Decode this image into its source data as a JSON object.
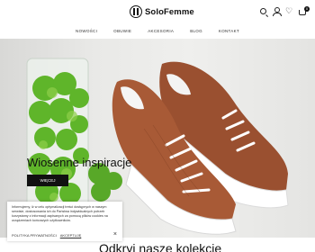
{
  "header": {
    "logo_text": "SoloFemme",
    "cart_count": "0"
  },
  "nav": {
    "items": [
      "NOWOŚCI",
      "OBUWIE",
      "AKCESORIA",
      "BLOG",
      "KONTAKT"
    ]
  },
  "hero": {
    "title": "Wiosenne inspiracje",
    "button_label": "WIĘCEJ"
  },
  "cookie": {
    "text": "Informujemy, iż w celu optymalizacji treści dostępnych w naszym serwisie, dostosowania ich do Państwa indywidualnych potrzeb korzystamy z informacji zapisanych za pomocą plików cookies na urządzeniach końcowych użytkowników.",
    "policy_label": "POLITYKA PRYWATNOŚCI",
    "accept_label": "AKCEPTUJĘ",
    "close_icon": "×"
  },
  "section": {
    "title": "Odkryj nasze kolekcje"
  },
  "colors": {
    "accent": "#111111",
    "leather": "#9a5030",
    "sole": "#ffffff",
    "moss": "#5fb52a"
  },
  "icons": [
    "search-icon",
    "user-icon",
    "heart-icon",
    "cart-icon"
  ]
}
